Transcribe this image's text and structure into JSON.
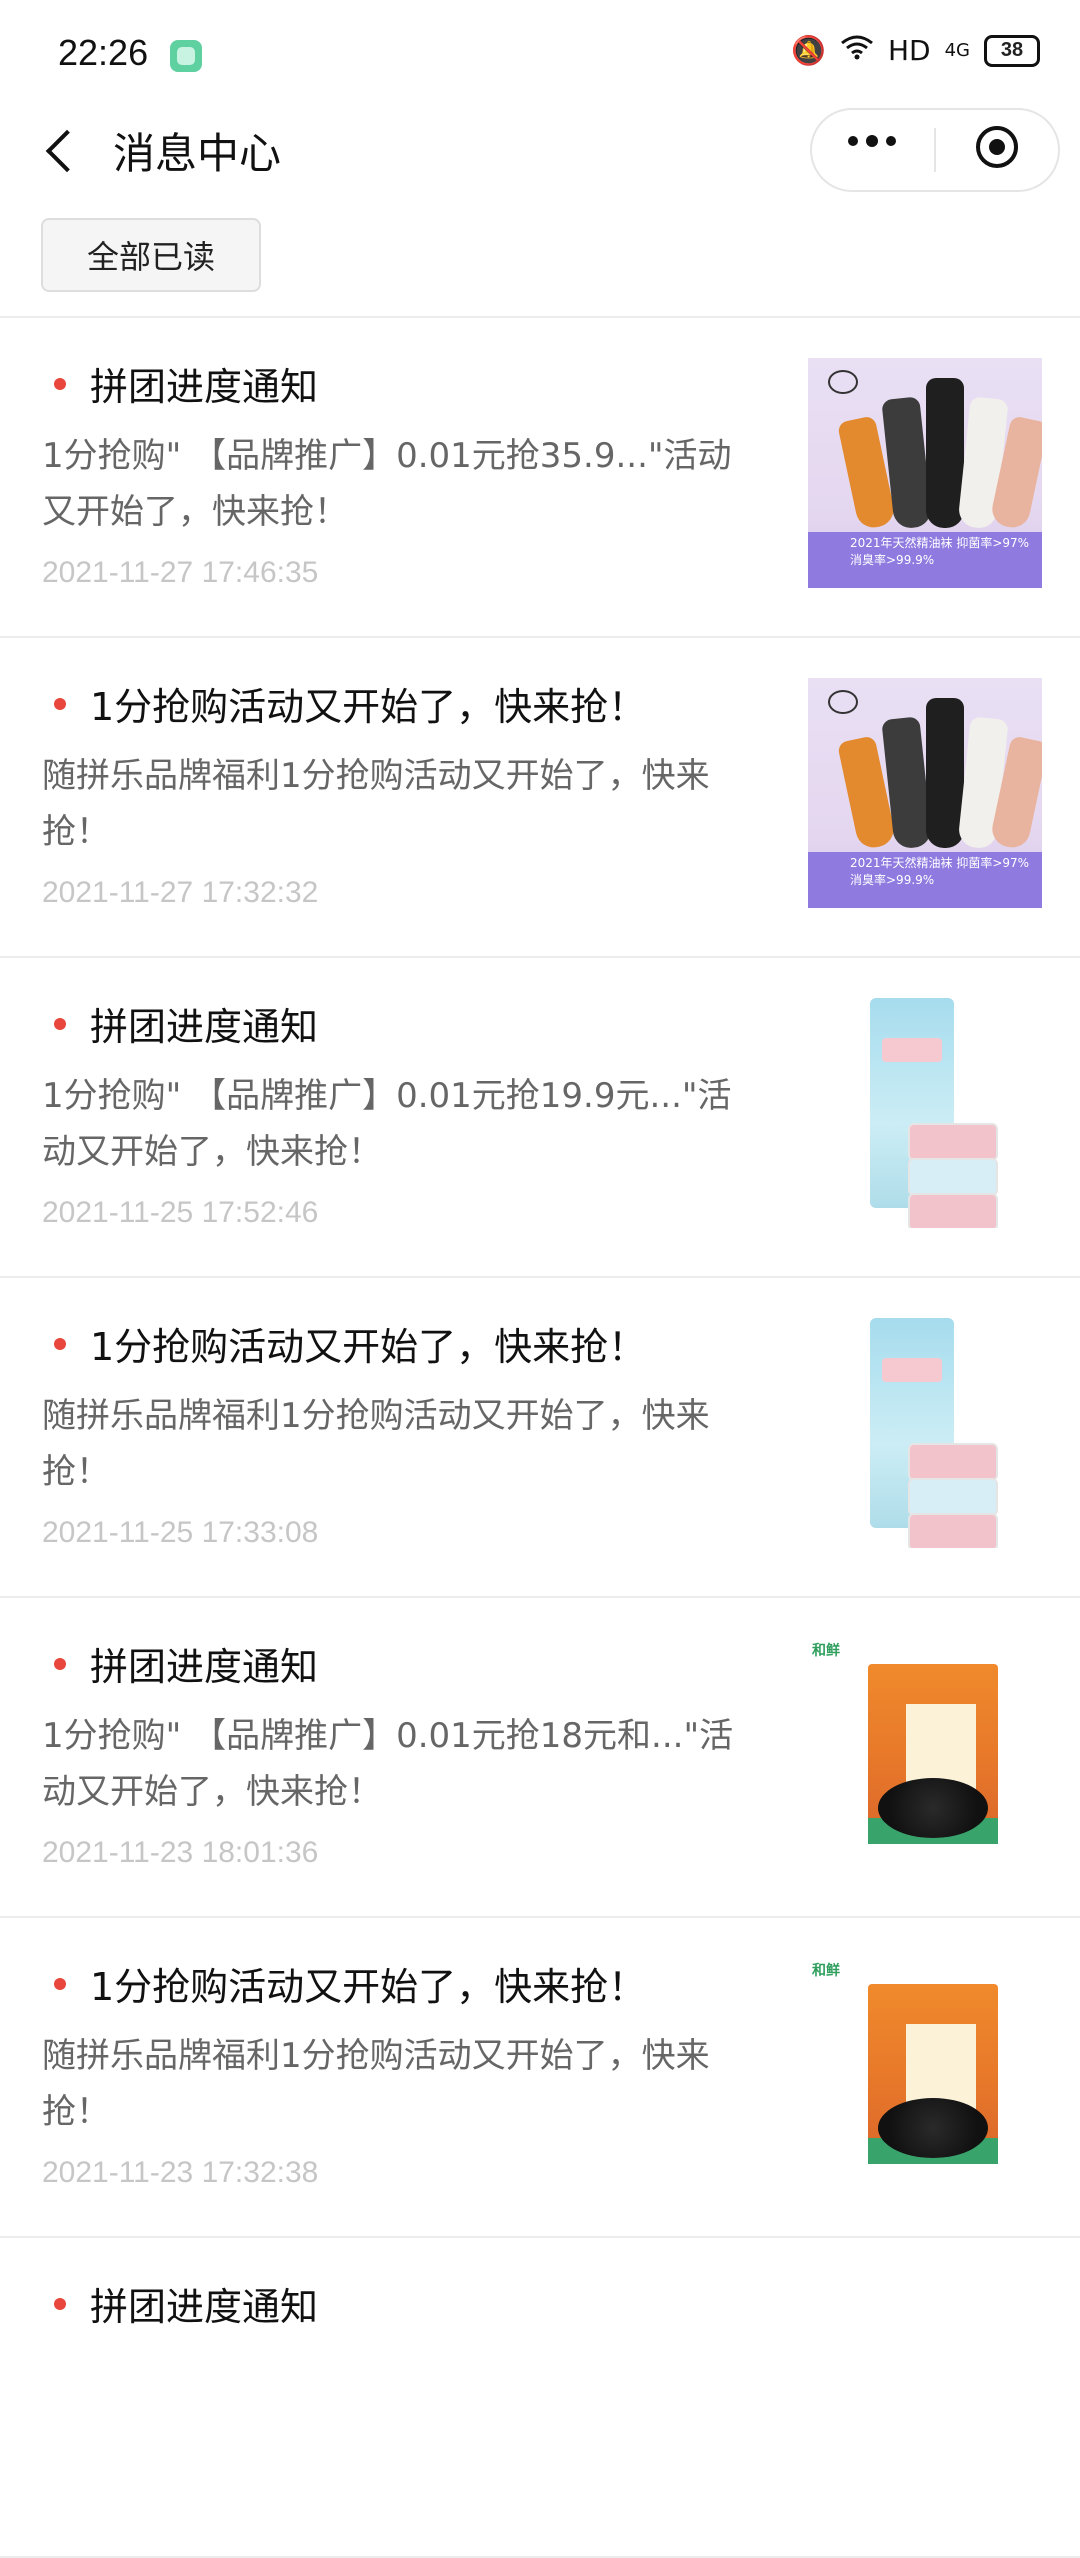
{
  "status_bar": {
    "time": "22:26",
    "mute_icon": "🔕",
    "wifi_icon": "wifi-icon",
    "network": "HD",
    "signal": "4G",
    "battery": "38"
  },
  "nav": {
    "title": "消息中心",
    "back_icon": "chevron-left-icon",
    "more_icon": "more-dots-icon",
    "target_icon": "target-icon"
  },
  "mark_all_read": "全部已读",
  "messages": [
    {
      "title": "拼团进度通知",
      "body": "1分抢购\" 【品牌推广】0.01元抢35.9...\"活动又开始了，快来抢！",
      "time": "2021-11-27 17:46:35",
      "thumbnail": "socks",
      "thumb_text": "2021年天然精油袜 抑菌率>97% 消臭率>99.9%"
    },
    {
      "title": "1分抢购活动又开始了，快来抢！",
      "body": "随拼乐品牌福利1分抢购活动又开始了，快来抢！",
      "time": "2021-11-27 17:32:32",
      "thumbnail": "socks",
      "thumb_text": "2021年天然精油袜 抑菌率>97% 消臭率>99.9%"
    },
    {
      "title": "拼团进度通知",
      "body": "1分抢购\" 【品牌推广】0.01元抢19.9元...\"活动又开始了，快来抢！",
      "time": "2021-11-25 17:52:46",
      "thumbnail": "wipes"
    },
    {
      "title": "1分抢购活动又开始了，快来抢！",
      "body": "随拼乐品牌福利1分抢购活动又开始了，快来抢！",
      "time": "2021-11-25 17:33:08",
      "thumbnail": "wipes"
    },
    {
      "title": "拼团进度通知",
      "body": "1分抢购\" 【品牌推广】0.01元抢18元和...\"活动又开始了，快来抢！",
      "time": "2021-11-23 18:01:36",
      "thumbnail": "douchi",
      "thumb_text": "和鲜"
    },
    {
      "title": "1分抢购活动又开始了，快来抢！",
      "body": "随拼乐品牌福利1分抢购活动又开始了，快来抢！",
      "time": "2021-11-23 17:32:38",
      "thumbnail": "douchi",
      "thumb_text": "和鲜"
    },
    {
      "title": "拼团进度通知",
      "body": "",
      "time": "",
      "thumbnail": ""
    }
  ],
  "colors": {
    "unread_dot": "#e8453c",
    "divider": "#ececec",
    "body_text": "#666666",
    "time_text": "#c6c6c6"
  }
}
